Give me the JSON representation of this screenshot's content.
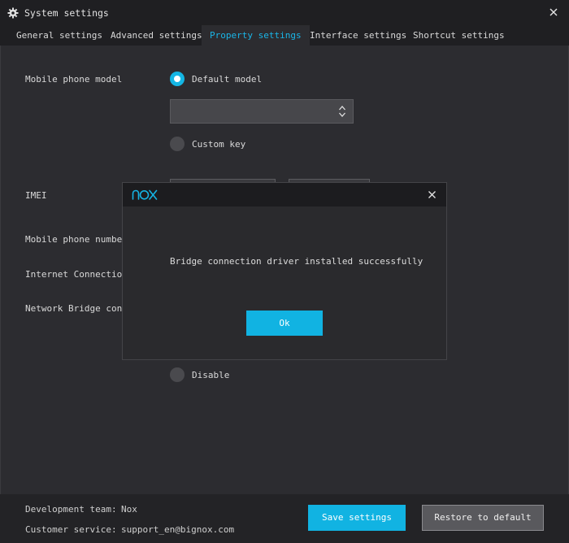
{
  "window": {
    "title": "System settings",
    "title_icon": "gear-icon",
    "close_icon": "close-icon"
  },
  "tabs": [
    {
      "label": "General settings",
      "active": false
    },
    {
      "label": "Advanced settings",
      "active": false
    },
    {
      "label": "Property settings",
      "active": true
    },
    {
      "label": "Interface settings",
      "active": false
    },
    {
      "label": "Shortcut settings",
      "active": false
    }
  ],
  "form": {
    "mobile_model_label": "Mobile phone model",
    "default_model_option": "Default model",
    "default_model_selected": true,
    "model_select_value": "",
    "custom_key_option": "Custom key",
    "custom_key_selected": false,
    "imei_label": "IMEI",
    "phone_number_label": "Mobile phone number",
    "internet_label": "Internet Connection",
    "bridge_label": "Network Bridge conne",
    "disable_option": "Disable",
    "disable_selected": false
  },
  "footer": {
    "dev_team_label": "Development team:",
    "dev_team_value": "Nox",
    "customer_service_label": "Customer service:",
    "customer_service_value": "support_en@bignox.com",
    "save_button": "Save settings",
    "restore_button": "Restore to default"
  },
  "dialog": {
    "logo": "nox-logo",
    "message": "Bridge connection driver installed successfully",
    "ok_button": "Ok"
  },
  "colors": {
    "accent": "#14b6e4",
    "background": "#2c2c30",
    "titlebar": "#1f1f22"
  }
}
